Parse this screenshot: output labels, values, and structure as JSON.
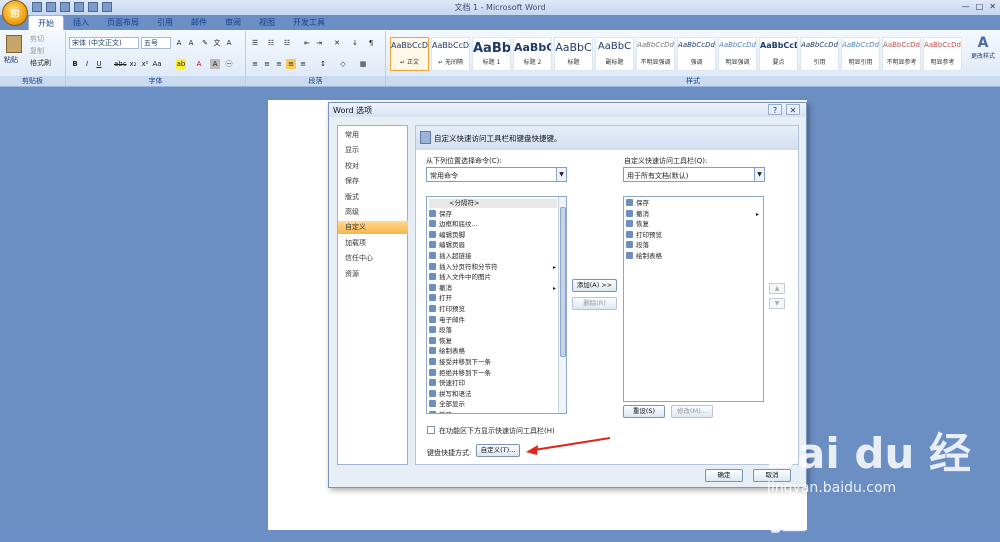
{
  "window": {
    "title": "文档 1 - Microsoft Word"
  },
  "tabs": [
    "开始",
    "插入",
    "页面布局",
    "引用",
    "邮件",
    "审阅",
    "视图",
    "开发工具"
  ],
  "ribbon": {
    "clipboard": {
      "paste": "粘贴",
      "cut": "剪切",
      "copy": "复制",
      "format_painter": "格式刷",
      "label": "剪贴板"
    },
    "font": {
      "font_name": "宋体 (中文正文)",
      "font_size": "五号",
      "label": "字体"
    },
    "paragraph": {
      "label": "段落"
    },
    "styles": {
      "label": "样式",
      "change_styles": "更改样式",
      "items": [
        {
          "sample": "AaBbCcDd",
          "name": "↵ 正文"
        },
        {
          "sample": "AaBbCcDd",
          "name": "↵ 无间隔"
        },
        {
          "sample": "AaBb",
          "name": "标题 1"
        },
        {
          "sample": "AaBbC",
          "name": "标题 2"
        },
        {
          "sample": "AaBbC",
          "name": "标题"
        },
        {
          "sample": "AaBbC",
          "name": "副标题"
        },
        {
          "sample": "AaBbCcDd",
          "name": "不明显强调"
        },
        {
          "sample": "AaBbCcDd",
          "name": "强调"
        },
        {
          "sample": "AaBbCcDd",
          "name": "明显强调"
        },
        {
          "sample": "AaBbCcDd",
          "name": "要点"
        },
        {
          "sample": "AaBbCcDd",
          "name": "引用"
        },
        {
          "sample": "AaBbCcDd",
          "name": "明显引用"
        },
        {
          "sample": "AaBbCcDd",
          "name": "不明显参考"
        },
        {
          "sample": "AaBbCcDd",
          "name": "明显参考"
        }
      ]
    }
  },
  "dialog": {
    "title": "Word 选项",
    "nav": [
      "常用",
      "显示",
      "校对",
      "保存",
      "版式",
      "高级",
      "自定义",
      "加载项",
      "信任中心",
      "资源"
    ],
    "selected_nav": "自定义",
    "header": "自定义快速访问工具栏和键盘快捷键。",
    "choose_from_label": "从下列位置选择命令(C):",
    "choose_from_value": "常用命令",
    "customize_qat_label": "自定义快速访问工具栏(Q):",
    "customize_qat_value": "用于所有文档(默认)",
    "commands": [
      "<分隔符>",
      "保存",
      "边框和底纹...",
      "编辑页脚",
      "编辑页眉",
      "插入超链接",
      "插入分页符和分节符",
      "插入文件中的图片",
      "撤消",
      "打开",
      "打印预览",
      "电子邮件",
      "段落",
      "恢复",
      "绘制表格",
      "接受并移到下一条",
      "拒绝并移到下一条",
      "快速打印",
      "拼写和语法",
      "全部显示",
      "新建"
    ],
    "qat_items": [
      "保存",
      "撤消",
      "恢复",
      "打印预览",
      "段落",
      "绘制表格"
    ],
    "add_button": "添加(A) >>",
    "remove_button": "删除(R)",
    "reset_button": "重设(S)",
    "modify_button": "修改(M)...",
    "show_below_ribbon": "在功能区下方显示快速访问工具栏(H)",
    "keyboard_label": "键盘快捷方式:",
    "customize_button": "自定义(T)...",
    "ok_button": "确定",
    "cancel_button": "取消"
  },
  "watermark": {
    "brand": "Bai du 经验",
    "url": "jingyan.baidu.com"
  }
}
